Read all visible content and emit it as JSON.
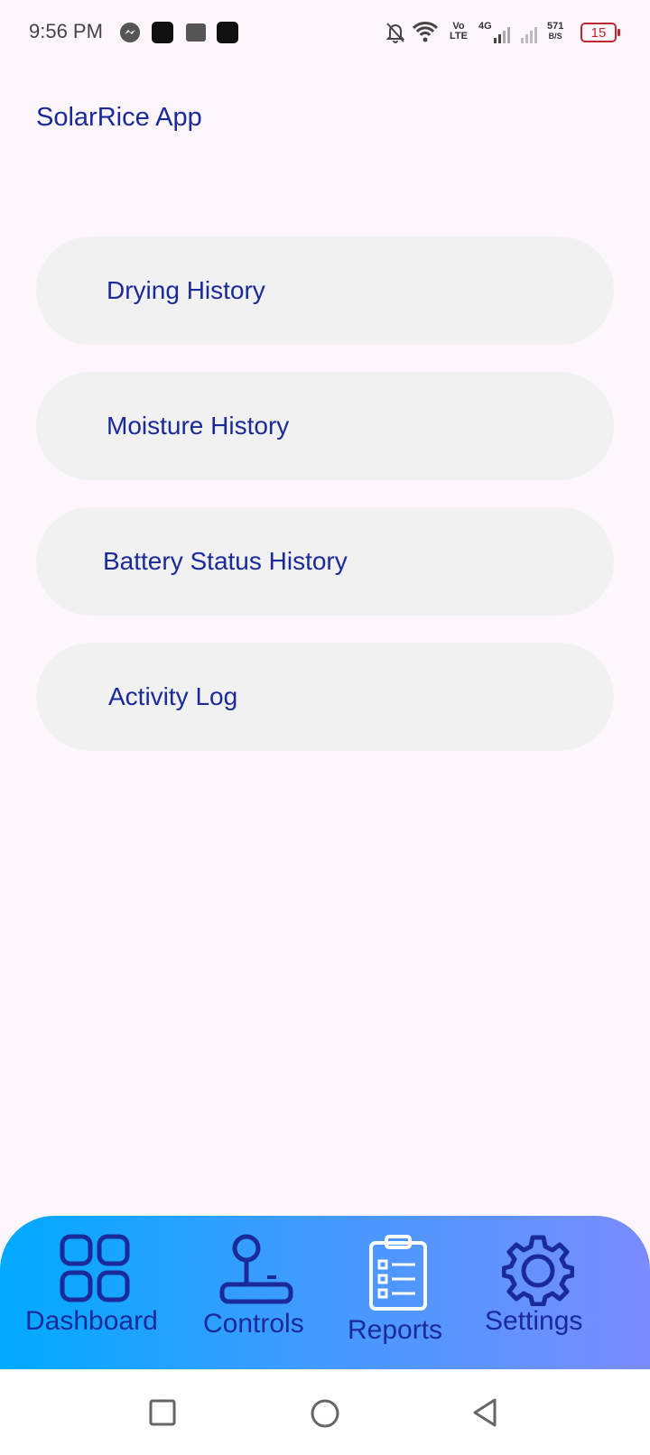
{
  "status_bar": {
    "time": "9:56 PM",
    "volte_top": "Vo",
    "volte_bottom": "LTE",
    "network": "4G",
    "speed_value": "571",
    "speed_unit": "B/S",
    "battery": "15",
    "battery_color": "#c0282f"
  },
  "header": {
    "title": "SolarRice App"
  },
  "menu": {
    "items": [
      {
        "label": "Drying History"
      },
      {
        "label": "Moisture History"
      },
      {
        "label": "Battery Status History"
      },
      {
        "label": "Activity Log"
      }
    ]
  },
  "bottom_nav": {
    "items": [
      {
        "label": "Dashboard",
        "icon": "grid-icon"
      },
      {
        "label": "Controls",
        "icon": "joystick-icon"
      },
      {
        "label": "Reports",
        "icon": "clipboard-icon"
      },
      {
        "label": "Settings",
        "icon": "gear-icon"
      }
    ],
    "gradient_start": "#00aaff",
    "gradient_end": "#7a8cff",
    "accent": "#1a2a9a"
  },
  "system_nav": {
    "buttons": [
      "recents-icon",
      "home-icon",
      "back-icon"
    ]
  }
}
